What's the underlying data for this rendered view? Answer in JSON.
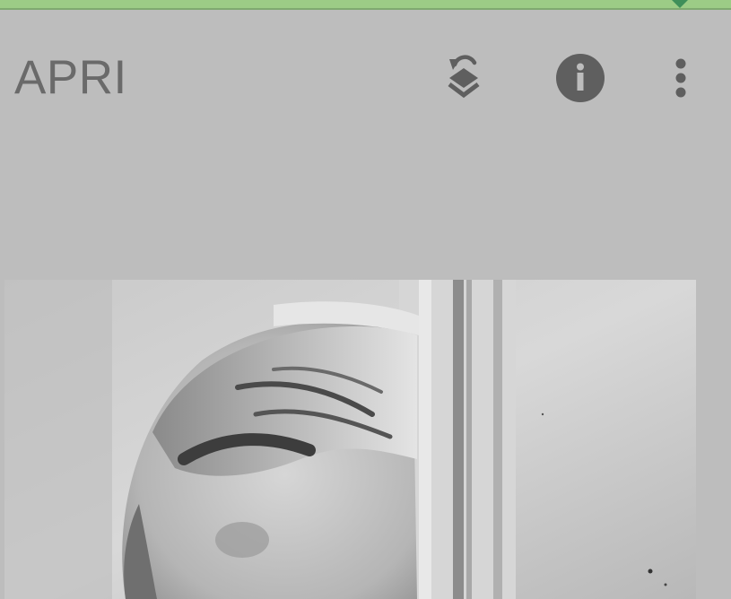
{
  "status_strip": {
    "color": "#9ccc86",
    "marker_color": "#3f8f5a"
  },
  "app_bar": {
    "title": "APRI",
    "actions": [
      {
        "icon": "layers-rotate-icon"
      },
      {
        "icon": "info-icon"
      },
      {
        "icon": "more-vert-icon"
      }
    ]
  },
  "content": {
    "image": {
      "style": "black-and-white photograph"
    }
  }
}
